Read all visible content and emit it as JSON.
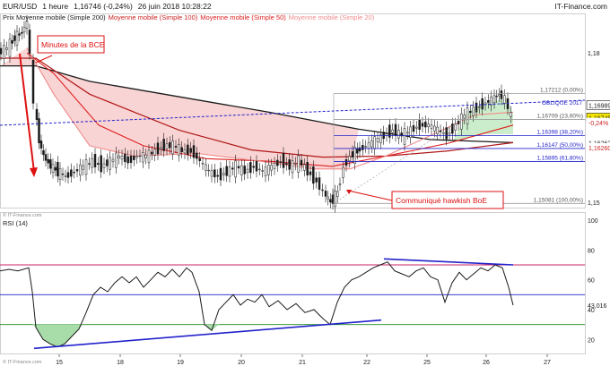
{
  "header": {
    "symbol": "EUR/USD",
    "period": "1 heure",
    "last": "1,16746 (-0,24%)",
    "datetime": "26 juin 2018 10:28:22",
    "brand": "IT-Finance.com",
    "ma_labels": [
      {
        "text": "Prix Moyenne mobile (Simple 200)",
        "color": "#1a1a1a"
      },
      {
        "text": "Moyenne mobile (Simple 100)",
        "color": "#cc2222"
      },
      {
        "text": "Moyenne mobile (Simple 50)",
        "color": "#e02020"
      },
      {
        "text": "Moyenne mobile (Simple 20)",
        "color": "#f08a8a"
      }
    ]
  },
  "annotations": {
    "bce": "Minutes de la BCE",
    "hawkish": "Communiqué hawkish BoE",
    "oblique": "OBLIQUE 2017",
    "copyright_top": "© IT-Finance.com",
    "copyright_bottom": "© IT-Finance.com"
  },
  "chart_data": [
    {
      "type": "candlestick",
      "panel": "price",
      "x_ticks": [
        "15",
        "18",
        "19",
        "20",
        "21",
        "22",
        "25",
        "26",
        "27"
      ],
      "y_ticks": [
        "1,18",
        "1,15"
      ],
      "ylim": [
        1.15,
        1.1875
      ],
      "price_labels": [
        {
          "text": "1,16989",
          "value": 1.16989,
          "bg": "#ffffff",
          "fg": "#1a1a1a",
          "border": "#1a1a1a"
        },
        {
          "text": "1,16745",
          "value": 1.16745,
          "bg": "#f5e600",
          "fg": "#1a1a1a",
          "border": "#1a1a1a"
        },
        {
          "text": "-0,24%",
          "value": 1.1665,
          "bg": "#ffffff",
          "fg": "#cc2222",
          "border": "#ffffff"
        },
        {
          "text": "1,16262",
          "value": 1.16262,
          "bg": "#ffffff",
          "fg": "#1a1a1a",
          "border": "#ffffff"
        },
        {
          "text": "1,16260",
          "value": 1.1616,
          "bg": "#ffffff",
          "fg": "#cc2222",
          "border": "#ffffff"
        }
      ],
      "fibonacci": [
        {
          "text": "1,17212 (0,00%)",
          "value": 1.17212
        },
        {
          "text": "1,16709 (23,60%)",
          "value": 1.16709
        },
        {
          "text": "1,16398 (38,20%)",
          "value": 1.16398
        },
        {
          "text": "1,16147 (50,00%)",
          "value": 1.16147
        },
        {
          "text": "1,15895 (61,80%)",
          "value": 1.15895
        },
        {
          "text": "1,15081 (100,00%)",
          "value": 1.15081
        }
      ],
      "close_path": [
        [
          0,
          1.18
        ],
        [
          10,
          1.181
        ],
        [
          18,
          1.183
        ],
        [
          26,
          1.184
        ],
        [
          32,
          1.186
        ],
        [
          36,
          1.179
        ],
        [
          40,
          1.17
        ],
        [
          45,
          1.163
        ],
        [
          50,
          1.16
        ],
        [
          58,
          1.158
        ],
        [
          66,
          1.157
        ],
        [
          75,
          1.156
        ],
        [
          85,
          1.157
        ],
        [
          95,
          1.158
        ],
        [
          105,
          1.159
        ],
        [
          115,
          1.158
        ],
        [
          125,
          1.159
        ],
        [
          135,
          1.16
        ],
        [
          145,
          1.159
        ],
        [
          155,
          1.16
        ],
        [
          165,
          1.16
        ],
        [
          175,
          1.161
        ],
        [
          185,
          1.162
        ],
        [
          195,
          1.162
        ],
        [
          205,
          1.161
        ],
        [
          215,
          1.161
        ],
        [
          225,
          1.159
        ],
        [
          235,
          1.157
        ],
        [
          245,
          1.156
        ],
        [
          255,
          1.157
        ],
        [
          265,
          1.158
        ],
        [
          275,
          1.157
        ],
        [
          285,
          1.158
        ],
        [
          295,
          1.157
        ],
        [
          305,
          1.158
        ],
        [
          315,
          1.159
        ],
        [
          325,
          1.158
        ],
        [
          335,
          1.159
        ],
        [
          345,
          1.157
        ],
        [
          355,
          1.155
        ],
        [
          362,
          1.153
        ],
        [
          370,
          1.151
        ],
        [
          378,
          1.153
        ],
        [
          385,
          1.158
        ],
        [
          392,
          1.16
        ],
        [
          400,
          1.161
        ],
        [
          410,
          1.162
        ],
        [
          420,
          1.163
        ],
        [
          430,
          1.164
        ],
        [
          440,
          1.165
        ],
        [
          450,
          1.164
        ],
        [
          460,
          1.165
        ],
        [
          470,
          1.166
        ],
        [
          480,
          1.166
        ],
        [
          490,
          1.165
        ],
        [
          500,
          1.164
        ],
        [
          510,
          1.166
        ],
        [
          520,
          1.168
        ],
        [
          530,
          1.169
        ],
        [
          540,
          1.17
        ],
        [
          550,
          1.171
        ],
        [
          558,
          1.172
        ],
        [
          565,
          1.171
        ],
        [
          572,
          1.1675
        ]
      ],
      "ma200": [
        [
          0,
          1.1775
        ],
        [
          40,
          1.1775
        ],
        [
          100,
          1.1745
        ],
        [
          200,
          1.1715
        ],
        [
          300,
          1.1685
        ],
        [
          400,
          1.1652
        ],
        [
          480,
          1.1632
        ],
        [
          572,
          1.1626
        ]
      ],
      "ma100": [
        [
          0,
          1.179
        ],
        [
          40,
          1.179
        ],
        [
          100,
          1.172
        ],
        [
          200,
          1.165
        ],
        [
          280,
          1.1612
        ],
        [
          360,
          1.1598
        ],
        [
          430,
          1.16
        ],
        [
          500,
          1.161
        ],
        [
          572,
          1.1626
        ]
      ],
      "ma50": [
        [
          30,
          1.18
        ],
        [
          60,
          1.176
        ],
        [
          110,
          1.166
        ],
        [
          160,
          1.162
        ],
        [
          230,
          1.1595
        ],
        [
          300,
          1.159
        ],
        [
          370,
          1.158
        ],
        [
          430,
          1.16
        ],
        [
          500,
          1.1625
        ],
        [
          572,
          1.166
        ]
      ],
      "ma20": [
        [
          30,
          1.181
        ],
        [
          60,
          1.172
        ],
        [
          100,
          1.162
        ],
        [
          150,
          1.16
        ],
        [
          220,
          1.1605
        ],
        [
          290,
          1.159
        ],
        [
          350,
          1.1575
        ],
        [
          390,
          1.1575
        ],
        [
          430,
          1.16
        ],
        [
          480,
          1.164
        ],
        [
          530,
          1.168
        ],
        [
          572,
          1.1685
        ]
      ]
    },
    {
      "type": "line",
      "panel": "rsi",
      "title": "RSI (14)",
      "y_ticks": [
        "100",
        "80",
        "60",
        "40",
        "20"
      ],
      "ylim": [
        10,
        100
      ],
      "levels": [
        70,
        50,
        30
      ],
      "last_value": "43,016",
      "values": [
        [
          0,
          66
        ],
        [
          10,
          67
        ],
        [
          20,
          66
        ],
        [
          32,
          68
        ],
        [
          36,
          52
        ],
        [
          40,
          28
        ],
        [
          48,
          20
        ],
        [
          56,
          17
        ],
        [
          64,
          15
        ],
        [
          72,
          17
        ],
        [
          80,
          22
        ],
        [
          88,
          27
        ],
        [
          96,
          38
        ],
        [
          104,
          50
        ],
        [
          112,
          55
        ],
        [
          120,
          52
        ],
        [
          128,
          58
        ],
        [
          136,
          62
        ],
        [
          144,
          58
        ],
        [
          152,
          62
        ],
        [
          160,
          55
        ],
        [
          168,
          60
        ],
        [
          176,
          65
        ],
        [
          184,
          62
        ],
        [
          192,
          67
        ],
        [
          200,
          62
        ],
        [
          208,
          68
        ],
        [
          214,
          65
        ],
        [
          222,
          52
        ],
        [
          228,
          30
        ],
        [
          236,
          26
        ],
        [
          244,
          40
        ],
        [
          252,
          45
        ],
        [
          260,
          50
        ],
        [
          268,
          43
        ],
        [
          276,
          47
        ],
        [
          284,
          45
        ],
        [
          292,
          50
        ],
        [
          300,
          42
        ],
        [
          310,
          46
        ],
        [
          320,
          40
        ],
        [
          330,
          44
        ],
        [
          340,
          38
        ],
        [
          350,
          40
        ],
        [
          360,
          34
        ],
        [
          368,
          30
        ],
        [
          376,
          45
        ],
        [
          384,
          55
        ],
        [
          392,
          60
        ],
        [
          400,
          62
        ],
        [
          408,
          65
        ],
        [
          416,
          68
        ],
        [
          424,
          70
        ],
        [
          432,
          72
        ],
        [
          440,
          66
        ],
        [
          448,
          64
        ],
        [
          456,
          62
        ],
        [
          464,
          66
        ],
        [
          472,
          68
        ],
        [
          480,
          62
        ],
        [
          488,
          60
        ],
        [
          496,
          45
        ],
        [
          504,
          58
        ],
        [
          512,
          65
        ],
        [
          520,
          60
        ],
        [
          528,
          64
        ],
        [
          536,
          68
        ],
        [
          544,
          66
        ],
        [
          552,
          70
        ],
        [
          560,
          68
        ],
        [
          567,
          55
        ],
        [
          572,
          43
        ]
      ]
    }
  ]
}
